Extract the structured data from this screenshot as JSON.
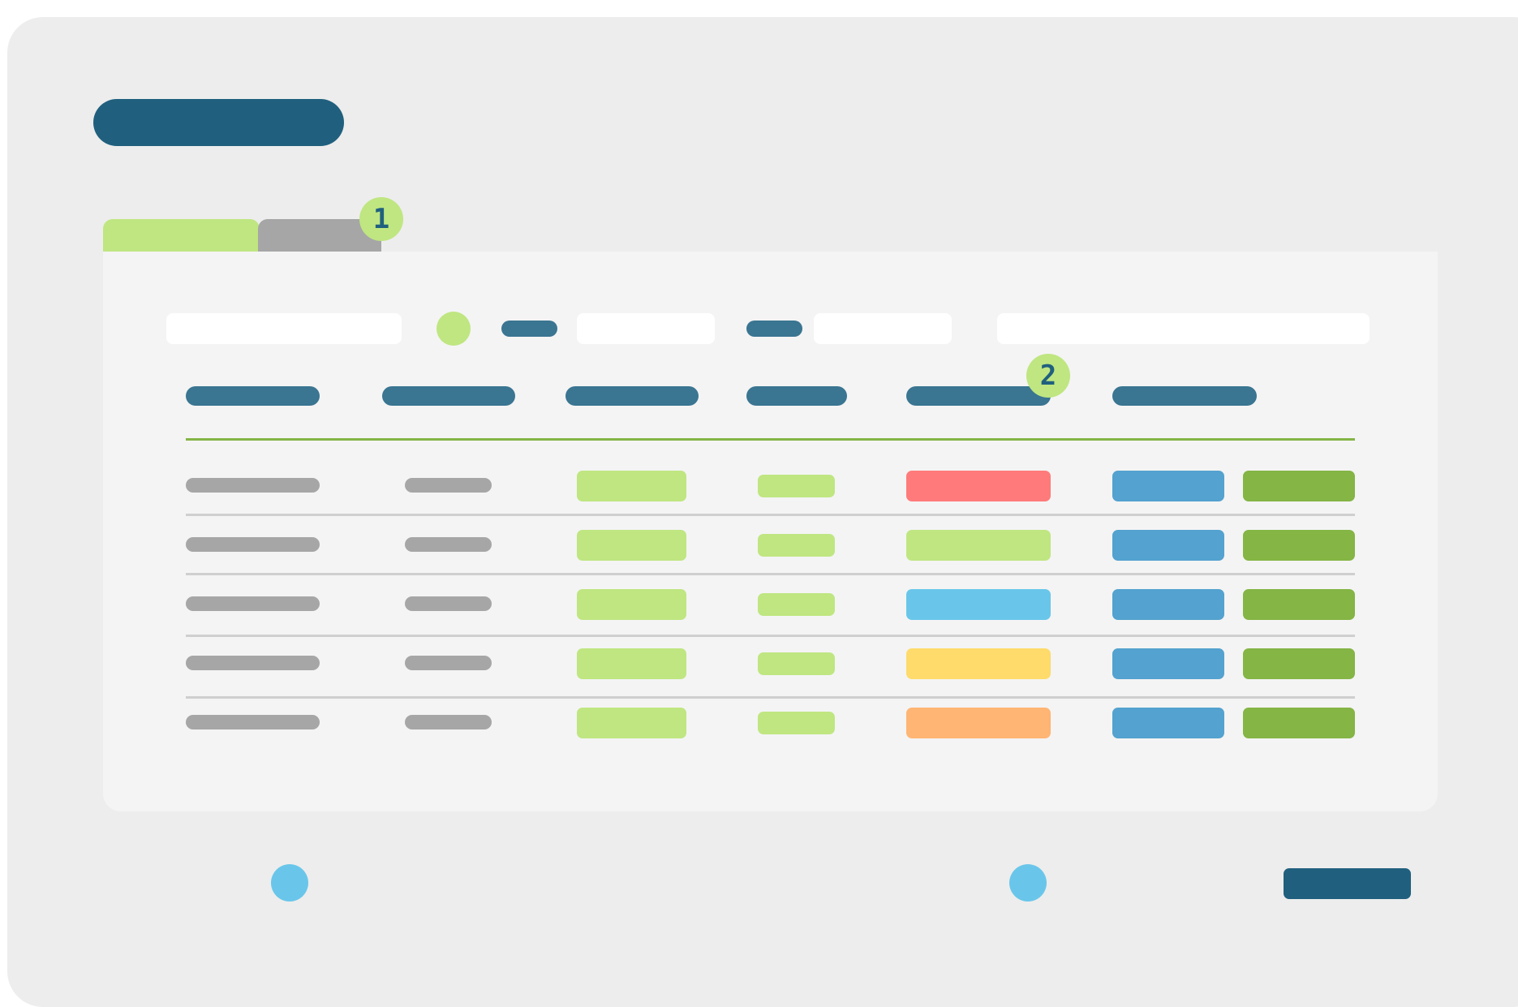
{
  "colors": {
    "frame_bg": "#ededed",
    "panel_bg": "#f4f4f4",
    "primary": "#20607e",
    "header_blue": "#3a7591",
    "lightgreen": "#bfe681",
    "tab_gray": "#a6a6a6",
    "badge": "#bfe681",
    "green_line": "#84b545",
    "cell_gray": "#a6a6a6",
    "light_blue": "#69c6ea",
    "status_red": "#ff7a7a",
    "status_green": "#bfe681",
    "status_blue": "#69c6ea",
    "status_yellow": "#fedb6b",
    "status_orange": "#ffb574",
    "action_blue": "#53a2cf",
    "action_green": "#84b545"
  },
  "badges": {
    "step1": "1",
    "step2": "2"
  },
  "icons": {
    "filter_dot": "green-circle-icon",
    "bottom_left_dot": "blue-circle-icon",
    "bottom_mid_dot": "blue-circle-icon"
  },
  "table": {
    "row_count": 5,
    "status_colors": [
      "status_red",
      "status_green",
      "status_blue",
      "status_yellow",
      "status_orange"
    ]
  }
}
